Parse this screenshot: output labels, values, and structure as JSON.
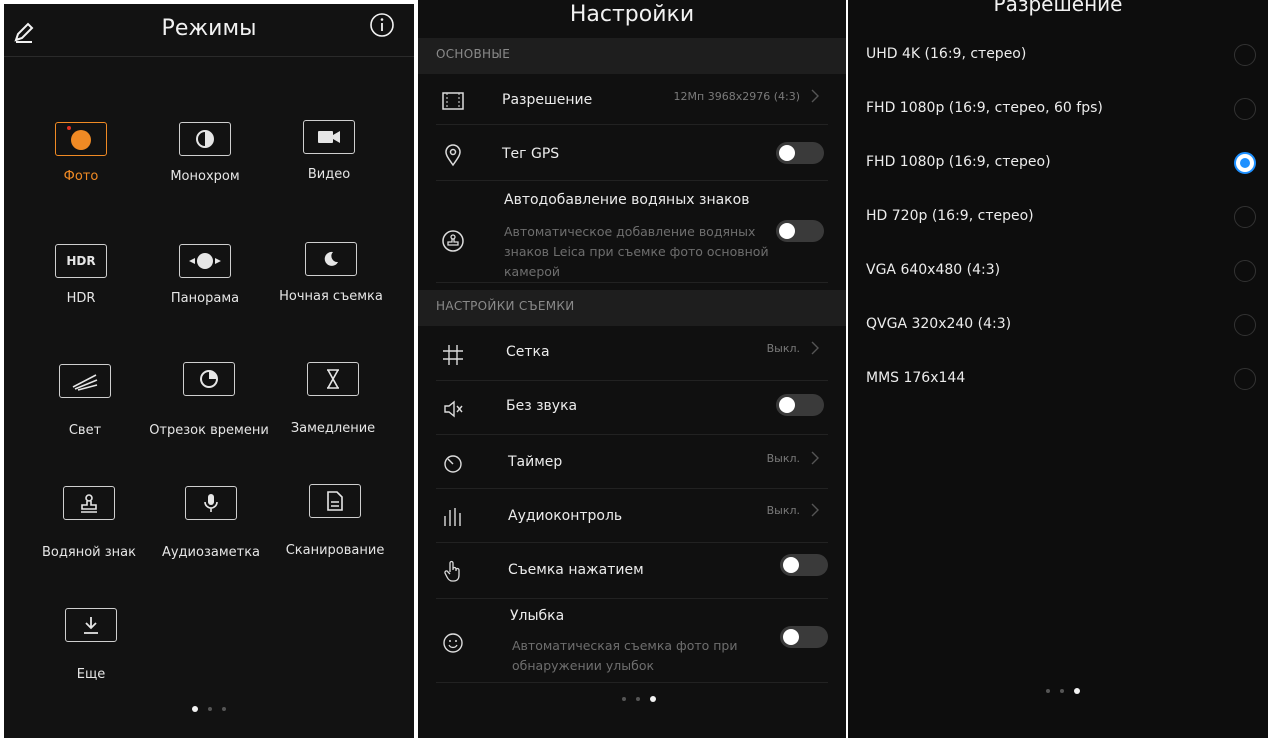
{
  "modes_panel": {
    "title": "Режимы",
    "modes": [
      {
        "label": "Фото",
        "icon": "photo-circle-icon",
        "active": true
      },
      {
        "label": "Монохром",
        "icon": "monochrome-icon"
      },
      {
        "label": "Видео",
        "icon": "video-camera-icon"
      },
      {
        "label": "HDR",
        "icon": "hdr-icon"
      },
      {
        "label": "Панорама",
        "icon": "panorama-icon"
      },
      {
        "label": "Ночная съемка",
        "icon": "night-moon-icon"
      },
      {
        "label": "Свет",
        "icon": "light-streak-icon"
      },
      {
        "label": "Отрезок времени",
        "icon": "timelapse-icon"
      },
      {
        "label": "Замедление",
        "icon": "hourglass-icon"
      },
      {
        "label": "Водяной знак",
        "icon": "watermark-stamp-icon"
      },
      {
        "label": "Аудиозаметка",
        "icon": "microphone-icon"
      },
      {
        "label": "Сканирование",
        "icon": "document-scan-icon"
      },
      {
        "label": "Еще",
        "icon": "download-icon"
      }
    ],
    "hdr_icon_text": "HDR"
  },
  "settings_panel": {
    "title": "Настройки",
    "section_main": "ОСНОВНЫЕ",
    "resolution_label": "Разрешение",
    "resolution_value": "12Мп 3968x2976 (4:3)",
    "gps_label": "Тег GPS",
    "watermark_label": "Автодобавление водяных знаков",
    "watermark_sub": "Автоматическое добавление водяных знаков Leica при съемке фото основной камерой",
    "section_shoot": "НАСТРОЙКИ СЪЕМКИ",
    "grid_label": "Сетка",
    "grid_value": "Выкл.",
    "mute_label": "Без звука",
    "timer_label": "Таймер",
    "timer_value": "Выкл.",
    "audio_label": "Аудиоконтроль",
    "audio_value": "Выкл.",
    "touch_label": "Съемка нажатием",
    "smile_label": "Улыбка",
    "smile_sub": "Автоматическая съемка фото при обнаружении улыбок"
  },
  "resolution_panel": {
    "title": "Разрешение",
    "options": [
      {
        "label": "UHD 4K (16:9, стерео)",
        "selected": false
      },
      {
        "label": "FHD 1080p (16:9, стерео, 60 fps)",
        "selected": false
      },
      {
        "label": "FHD 1080p (16:9, стерео)",
        "selected": true
      },
      {
        "label": "HD 720p (16:9, стерео)",
        "selected": false
      },
      {
        "label": "VGA 640x480 (4:3)",
        "selected": false
      },
      {
        "label": "QVGA 320x240 (4:3)",
        "selected": false
      },
      {
        "label": "MMS 176x144",
        "selected": false
      }
    ]
  },
  "colors": {
    "accent_orange": "#f08a24",
    "radio_blue": "#1e90ff"
  }
}
